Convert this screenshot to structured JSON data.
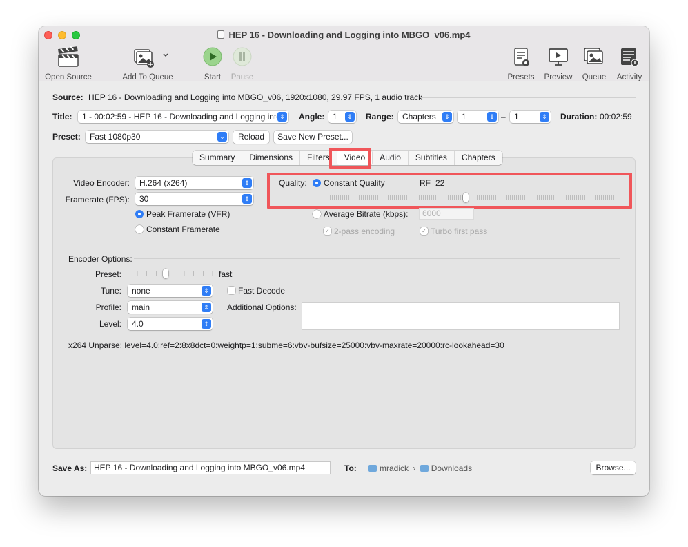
{
  "window": {
    "title": "HEP 16 - Downloading and Logging into MBGO_v06.mp4"
  },
  "toolbar": {
    "open_source": "Open Source",
    "add_to_queue": "Add To Queue",
    "start": "Start",
    "pause": "Pause",
    "presets": "Presets",
    "preview": "Preview",
    "queue": "Queue",
    "activity": "Activity"
  },
  "source": {
    "label": "Source:",
    "value": "HEP 16 - Downloading and Logging into MBGO_v06, 1920x1080, 29.97 FPS, 1 audio track"
  },
  "title_row": {
    "title_label": "Title:",
    "title_value": "1 - 00:02:59 - HEP 16 - Downloading and Logging into",
    "angle_label": "Angle:",
    "angle_value": "1",
    "range_label": "Range:",
    "range_value": "Chapters",
    "range_start": "1",
    "range_sep": "–",
    "range_end": "1",
    "duration_label": "Duration:",
    "duration_value": "00:02:59"
  },
  "preset_row": {
    "label": "Preset:",
    "value": "Fast 1080p30",
    "reload": "Reload",
    "save_new": "Save New Preset..."
  },
  "tabs": [
    "Summary",
    "Dimensions",
    "Filters",
    "Video",
    "Audio",
    "Subtitles",
    "Chapters"
  ],
  "active_tab": "Video",
  "video": {
    "encoder_label": "Video Encoder:",
    "encoder_value": "H.264 (x264)",
    "framerate_label": "Framerate (FPS):",
    "framerate_value": "30",
    "peak_framerate": "Peak Framerate (VFR)",
    "constant_framerate": "Constant Framerate",
    "quality_label": "Quality:",
    "constant_quality": "Constant Quality",
    "rf_label": "RF",
    "rf_value": "22",
    "quality_slider_fraction": 0.48,
    "avg_bitrate": "Average Bitrate (kbps):",
    "avg_bitrate_value": "6000",
    "two_pass": "2-pass encoding",
    "turbo": "Turbo first pass"
  },
  "encoder_options": {
    "title": "Encoder Options:",
    "preset_label": "Preset:",
    "preset_value": "fast",
    "preset_slider_fraction": 0.44,
    "tune_label": "Tune:",
    "tune_value": "none",
    "fast_decode": "Fast Decode",
    "profile_label": "Profile:",
    "profile_value": "main",
    "additional_label": "Additional Options:",
    "level_label": "Level:",
    "level_value": "4.0",
    "unparse": "x264 Unparse: level=4.0:ref=2:8x8dct=0:weightp=1:subme=6:vbv-bufsize=25000:vbv-maxrate=20000:rc-lookahead=30"
  },
  "save": {
    "label": "Save As:",
    "value": "HEP 16 - Downloading and Logging into MBGO_v06.mp4",
    "to_label": "To:",
    "path_user": "mradick",
    "path_sep": "›",
    "path_folder": "Downloads",
    "browse": "Browse..."
  },
  "colors": {
    "accent": "#2f7df6",
    "highlight": "#f0565a"
  }
}
